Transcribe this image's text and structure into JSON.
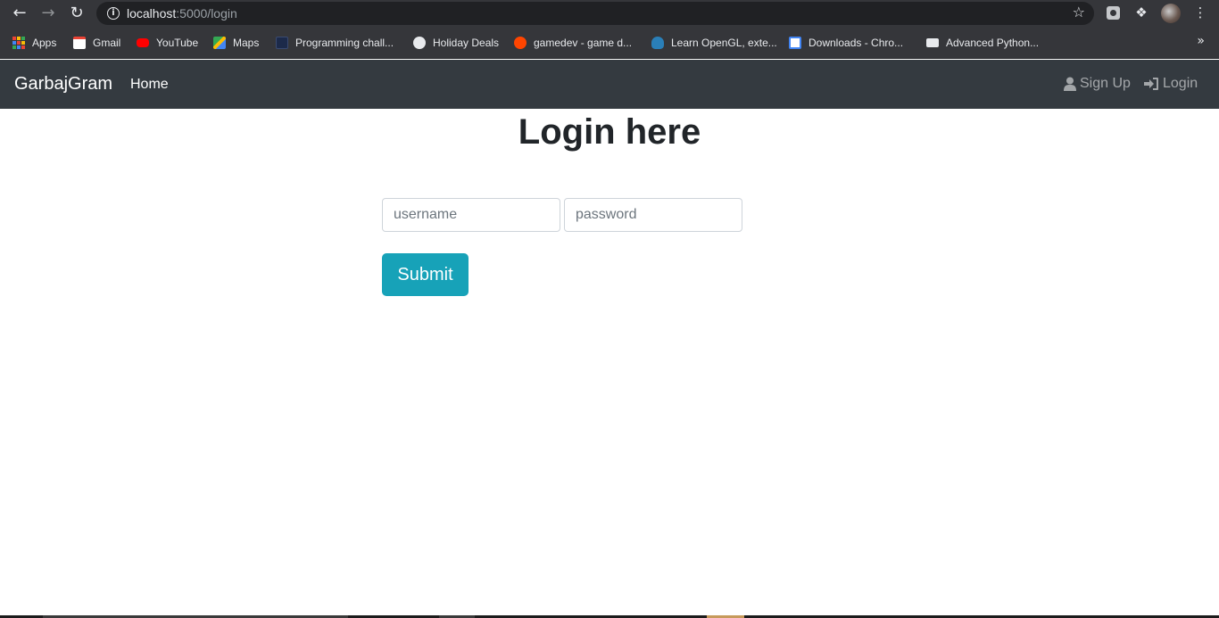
{
  "browser": {
    "url_host": "localhost",
    "url_rest": ":5000/login",
    "icons": [
      "back-icon",
      "forward-icon",
      "reload-icon",
      "info-icon",
      "star-icon",
      "extension-icon",
      "puzzle-icon",
      "profile-avatar",
      "menu-icon"
    ]
  },
  "bookmarks": [
    {
      "label": "Apps",
      "icon": "apps-grid-icon"
    },
    {
      "label": "Gmail",
      "icon": "gmail-icon"
    },
    {
      "label": "YouTube",
      "icon": "youtube-icon"
    },
    {
      "label": "Maps",
      "icon": "maps-icon"
    },
    {
      "label": "Programming chall...",
      "icon": "programming-icon"
    },
    {
      "label": "Holiday Deals",
      "icon": "globe-icon"
    },
    {
      "label": "gamedev - game d...",
      "icon": "reddit-icon"
    },
    {
      "label": "Learn OpenGL, exte...",
      "icon": "opengl-icon"
    },
    {
      "label": "Downloads - Chro...",
      "icon": "downloads-icon"
    },
    {
      "label": "Advanced Python...",
      "icon": "python-icon"
    }
  ],
  "navbar": {
    "brand": "GarbajGram",
    "home": "Home",
    "signup": "Sign Up",
    "login": "Login"
  },
  "main": {
    "title": "Login here",
    "username_placeholder": "username",
    "password_placeholder": "password",
    "submit": "Submit"
  },
  "colors": {
    "navbar_bg": "#343a40",
    "submit_bg": "#17a2b8",
    "chrome_bg": "#35363a"
  }
}
